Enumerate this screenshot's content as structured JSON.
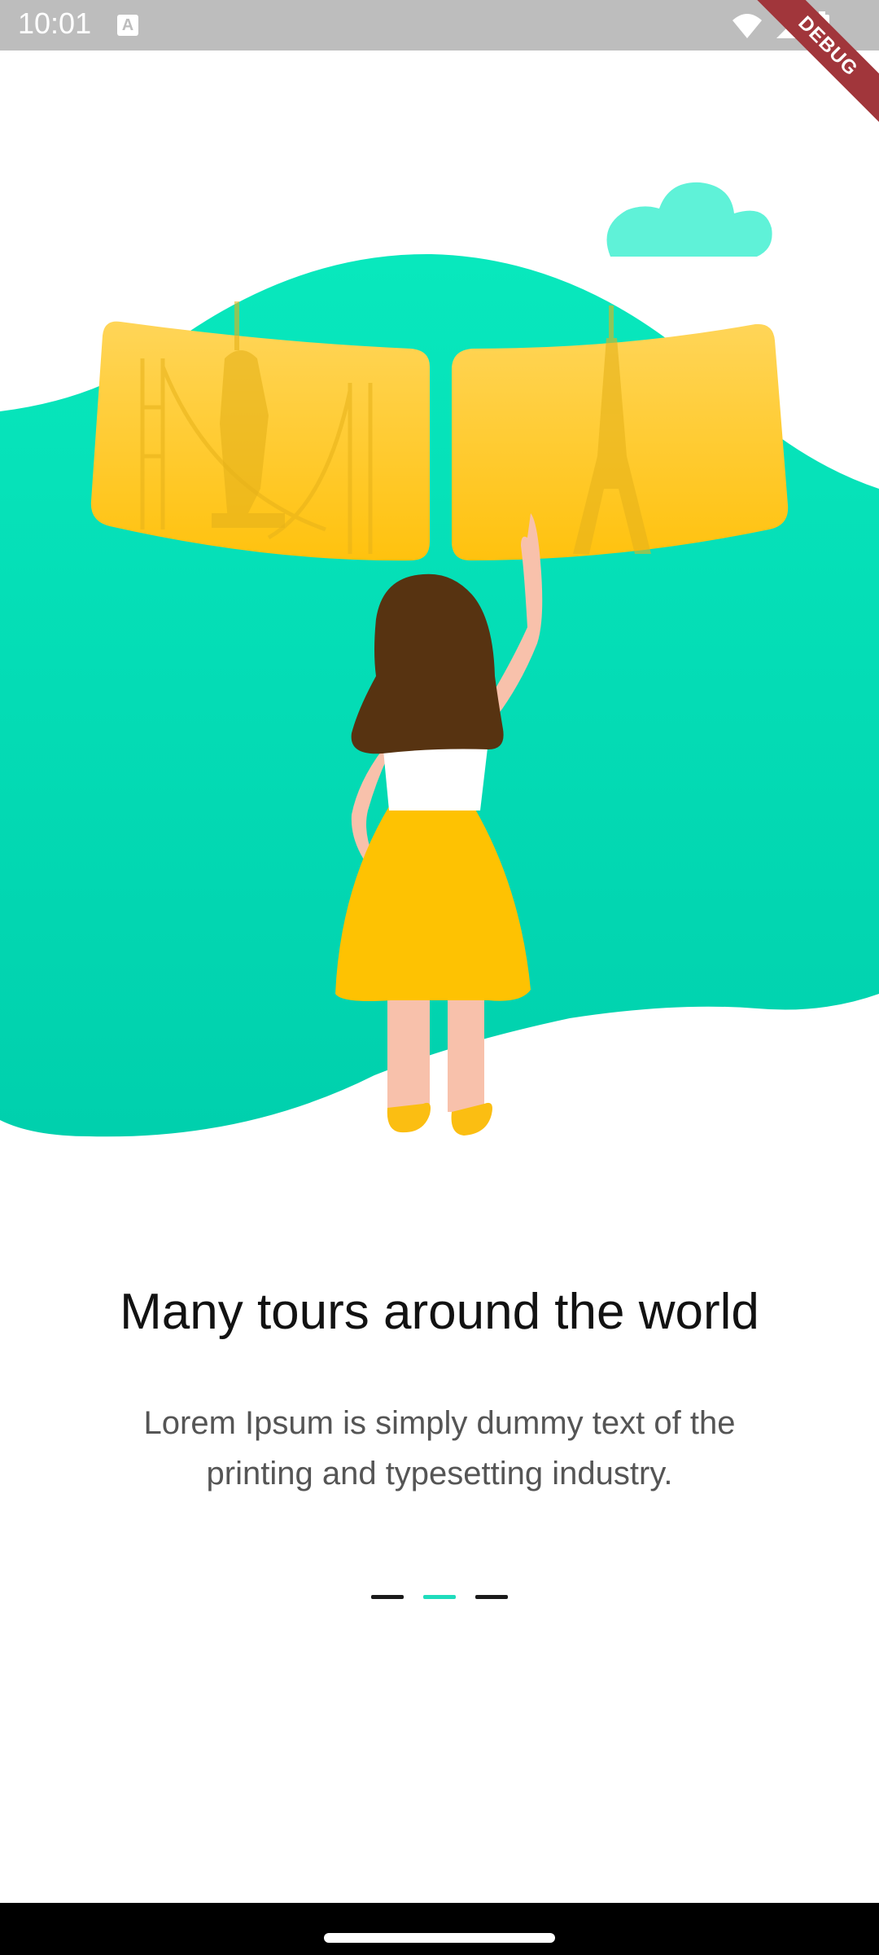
{
  "status_bar": {
    "time": "10:01"
  },
  "debug_banner": {
    "label": "DEBUG"
  },
  "onboarding": {
    "title": "Many tours around the world",
    "description": "Lorem Ipsum is simply dummy text of the printing and typesetting industry.",
    "page_count": 3,
    "current_page": 2
  },
  "colors": {
    "accent": "#1fdcbc",
    "hill": "#00d6b0",
    "card": "#ffc81a",
    "cloud": "#5ff2d8",
    "status_bar": "#bdbdbd",
    "debug_ribbon": "#a1363b"
  }
}
